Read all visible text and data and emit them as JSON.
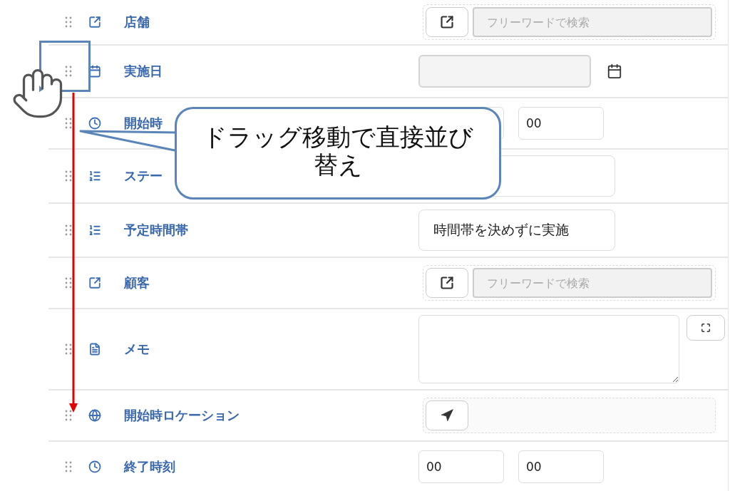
{
  "rows": [
    {
      "kind": "lookup",
      "label": "店舗",
      "placeholder": "フリーワードで検索"
    },
    {
      "kind": "date",
      "label": "実施日"
    },
    {
      "kind": "time",
      "label": "開始時",
      "minute": "00"
    },
    {
      "kind": "select",
      "label": "ステー"
    },
    {
      "kind": "select",
      "label": "予定時間帯",
      "value": "時間帯を決めずに実施"
    },
    {
      "kind": "lookup",
      "label": "顧客",
      "placeholder": "フリーワードで検索"
    },
    {
      "kind": "memo",
      "label": "メモ"
    },
    {
      "kind": "location",
      "label": "開始時ロケーション"
    },
    {
      "kind": "time",
      "label": "終了時刻",
      "hour": "00",
      "minute": "00"
    }
  ],
  "callout": {
    "text": "ドラッグ移動で直接並び替え"
  }
}
